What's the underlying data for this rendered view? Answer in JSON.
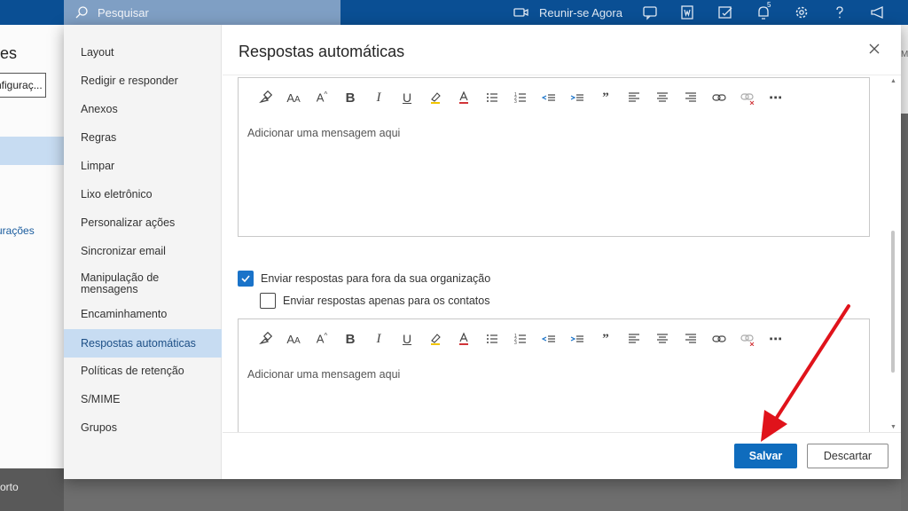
{
  "topbar": {
    "search_placeholder": "Pesquisar",
    "meet_now": "Reunir-se Agora",
    "notification_count": "5",
    "right_edge_text": "Mi"
  },
  "background": {
    "title_fragment": "es",
    "settings_box": "nfiguraç...",
    "link_fragment": "urações",
    "bottom_fragment": "orto"
  },
  "settings": {
    "nav_items": [
      "Layout",
      "Redigir e responder",
      "Anexos",
      "Regras",
      "Limpar",
      "Lixo eletrônico",
      "Personalizar ações",
      "Sincronizar email",
      "Manipulação de mensagens",
      "Encaminhamento",
      "Respostas automáticas",
      "Políticas de retenção",
      "S/MIME",
      "Grupos"
    ],
    "active_index": 10
  },
  "panel": {
    "title": "Respostas automáticas",
    "editor1_placeholder": "Adicionar uma mensagem aqui",
    "editor2_placeholder": "Adicionar uma mensagem aqui",
    "check_outside_label": "Enviar respostas para fora da sua organização",
    "check_outside_checked": true,
    "check_contacts_label": "Enviar respostas apenas para os contatos",
    "check_contacts_checked": false,
    "save_label": "Salvar",
    "discard_label": "Descartar"
  },
  "toolbar_icons": [
    "format-painter-icon",
    "font-size-icon",
    "font-grow-icon",
    "bold-icon",
    "italic-icon",
    "underline-icon",
    "highlight-icon",
    "font-color-icon",
    "bullets-icon",
    "numbering-icon",
    "decrease-indent-icon",
    "increase-indent-icon",
    "quote-icon",
    "align-left-icon",
    "align-center-icon",
    "align-right-icon",
    "link-icon",
    "unlink-icon",
    "more-icon"
  ],
  "colors": {
    "topbar": "#0a4f94",
    "accent": "#0f6cbd",
    "nav_active": "#c7dcf2",
    "annotation_arrow": "#e0131b"
  }
}
